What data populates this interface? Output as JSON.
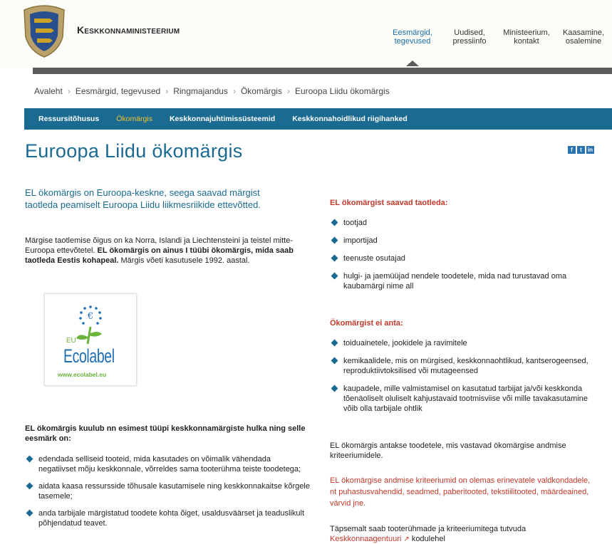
{
  "header": {
    "site_title": "Keskkonnaministeerium",
    "nav": [
      {
        "line1": "Eesmärgid,",
        "line2": "tegevused"
      },
      {
        "line1": "Uudised,",
        "line2": "pressiinfo"
      },
      {
        "line1": "Ministeerium,",
        "line2": "kontakt"
      },
      {
        "line1": "Kaasamine,",
        "line2": "osalemine"
      }
    ]
  },
  "breadcrumb": [
    "Avaleht",
    "Eesmärgid, tegevused",
    "Ringmajandus",
    "Ökomärgis",
    "Euroopa Liidu ökomärgis"
  ],
  "subnav": [
    "Ressursitõhusus",
    "Ökomärgis",
    "Keskkonnajuhtimissüsteemid",
    "Keskkonnahoidlikud riigihanked"
  ],
  "social": [
    "f",
    "t",
    "in"
  ],
  "main": {
    "title": "Euroopa Liidu ökomärgis",
    "lead": "EL ökomärgis on Euroopa-keskne, seega saavad märgist taotleda peamiselt Euroopa Liidu liikmesriikide ettevõtted.",
    "intro_plain": "Märgise taotlemise õigus on ka Norra, Islandi ja Liechtensteini ja teistel mitte-Euroopa ettevõtetel.",
    "intro_bold": "EL ökomärgis on ainus I tüübi ökomärgis, mida saab taotleda Eestis kohapeal.",
    "intro_tail": "Märgis võeti kasutusele 1992. aastal.",
    "ecolabel": {
      "eu": "EU",
      "name": "Ecolabel",
      "url": "www.ecolabel.eu"
    },
    "left_heading": "EL ökomärgis kuulub nn esimest tüüpi keskkonnamärgiste hulka ning selle eesmärk on:",
    "left_items": [
      "edendada selliseid tooteid, mida kasutades on võimalik vähendada negatiivset mõju keskkonnale, võrreldes sama tooterühma teiste toodetega;",
      "aidata kaasa ressursside tõhusale kasutamisele ning keskkonnakaitse kõrgele tasemele;",
      "anda tarbijale märgistatud toodete kohta õiget, usaldusväärset ja teaduslikult põhjendatud teavet."
    ]
  },
  "right": {
    "heading1": "EL ökomärgist saavad taotleda:",
    "list1": [
      "tootjad",
      "importijad",
      "teenuste osutajad",
      "hulgi- ja jaemüüjad nendele toodetele, mida nad turustavad oma kaubamärgi nime all"
    ],
    "heading2": "Ökomärgist ei anta:",
    "list2": [
      "toiduainetele, jookidele ja ravimitele",
      "kemikaalidele, mis on mürgised, keskkonnaohtlikud, kantserogeensed, reproduktiivtoksilised või mutageensed",
      "kaupadele, mille valmistamisel on kasutatud tarbijat ja/või keskkonda tõenäoliselt oluliselt kahjustavaid tootmisviise või mille tavakasutamine võib olla tarbijale ohtlik"
    ],
    "para1": "EL ökomärgis antakse toodetele, mis vastavad ökomärgise andmise kriteeriumidele.",
    "para2": "EL ökomärgise andmise kriteeriumid on olemas erinevatele valdkondadele, nt puhastusvahendid, seadmed, paberitooted, tekstiilitooted, määrdeained, värvid jne.",
    "para3_text": "Täpsemalt saab tooterühmade ja kriteeriumitega tutvuda",
    "para3_link": "Keskkonnaagentuuri",
    "para3_tail": "kodulehel"
  },
  "colors": {
    "brand_blue": "#1a6a91",
    "accent_red": "#c0392b",
    "active_yellow": "#f0c431"
  }
}
